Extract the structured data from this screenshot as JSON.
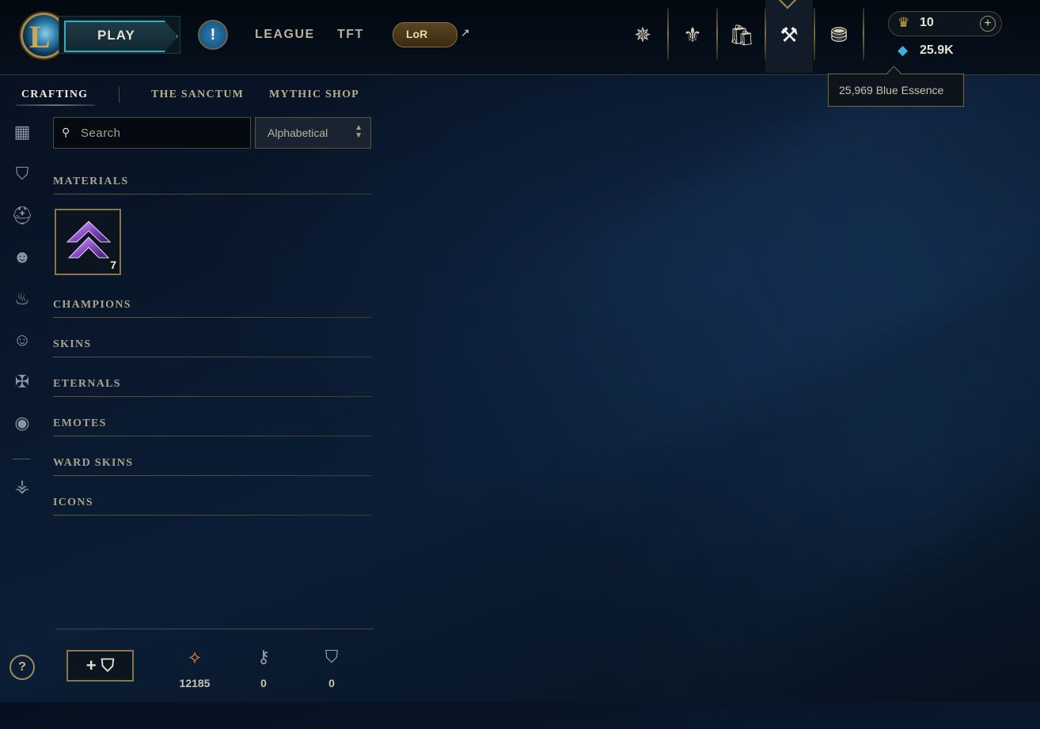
{
  "app": {
    "logo_letter": "L",
    "play_label": "PLAY",
    "alert_label": "!",
    "nav_links": [
      "LEAGUE",
      "TFT"
    ],
    "lor_label": "LoR",
    "external_arrow": "↗"
  },
  "nav_icons": [
    {
      "name": "profile-icon",
      "glyph": "✵"
    },
    {
      "name": "collection-icon",
      "glyph": "⚜"
    },
    {
      "name": "store-icon",
      "glyph": "🛍"
    },
    {
      "name": "loot-icon",
      "glyph": "⚒"
    },
    {
      "name": "currency-icon",
      "glyph": "⛃"
    }
  ],
  "wallet": {
    "rp_value": "10",
    "rp_add": "+",
    "be_value": "25.9K",
    "tooltip": "25,969 Blue Essence"
  },
  "sub_tabs": {
    "crafting": "CRAFTING",
    "sanctum": "THE SANCTUM",
    "mythic": "MYTHIC SHOP"
  },
  "search": {
    "placeholder": "Search"
  },
  "sort": {
    "selected": "Alphabetical"
  },
  "categories": {
    "materials": "MATERIALS",
    "champions": "CHAMPIONS",
    "skins": "SKINS",
    "eternals": "ETERNALS",
    "emotes": "EMOTES",
    "ward_skins": "WARD SKINS",
    "icons": "ICONS"
  },
  "materials_item": {
    "count": "7"
  },
  "sidebar_icons": [
    "grid-icon",
    "chest-icon",
    "helmet-icon",
    "mask-icon",
    "flame-icon",
    "emote-icon",
    "eternals-icon",
    "profile-circle-icon",
    "ward-icon"
  ],
  "footer": {
    "chest_button": "+ ⛉",
    "orange_essence": "12185",
    "keys": "0",
    "chests": "0"
  },
  "help_label": "?"
}
